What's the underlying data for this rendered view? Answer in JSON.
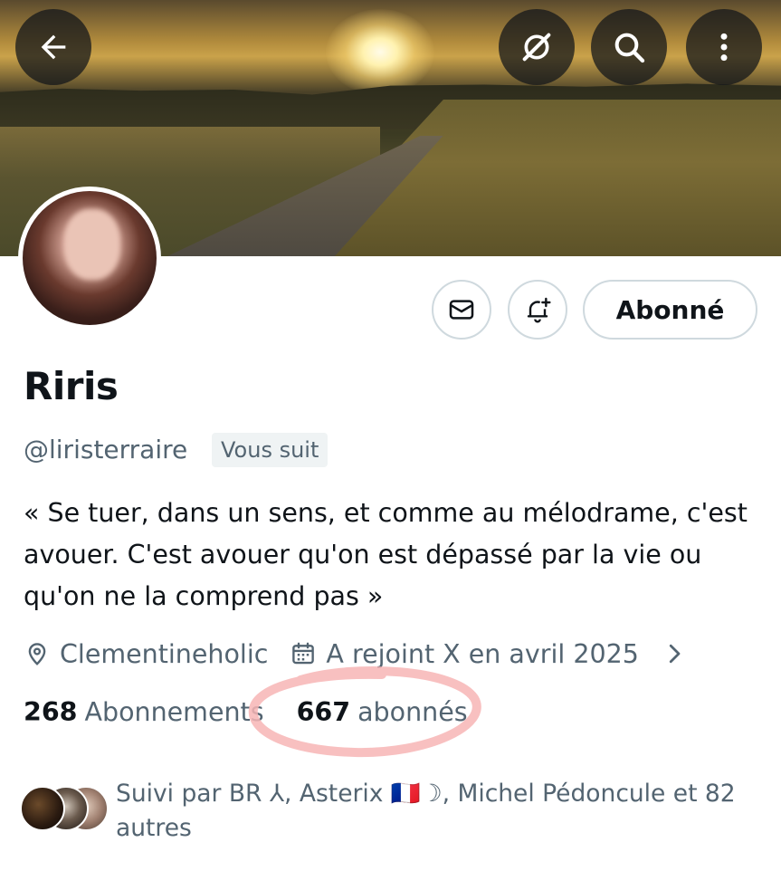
{
  "header": {
    "back_icon": "arrow-left-icon",
    "grok_icon": "grok-icon",
    "search_icon": "search-icon",
    "more_icon": "more-vertical-icon"
  },
  "profile": {
    "name": "Riris",
    "handle": "@liristerraire",
    "follows_you_badge": "Vous suit",
    "bio": "« Se tuer, dans un sens, et comme au mélodrame, c'est avouer. C'est avouer qu'on est dépassé par la vie ou qu'on ne la comprend pas »",
    "location": "Clementineholic",
    "joined": "A rejoint X en avril 2025"
  },
  "actions": {
    "message_icon": "envelope-icon",
    "notify_icon": "bell-plus-icon",
    "follow_label": "Abonné"
  },
  "stats": {
    "following_count": "268",
    "following_label": "Abonnements",
    "followers_count": "667",
    "followers_label": "abonnés"
  },
  "followed_by": {
    "text": "Suivi par BR ⅄, Asterix 🇫🇷☽, Michel Pédoncule et 82 autres"
  },
  "colors": {
    "text_primary": "#0f1419",
    "text_secondary": "#536471",
    "border": "#cfd9de",
    "highlight_circle": "#f7b5b5"
  }
}
